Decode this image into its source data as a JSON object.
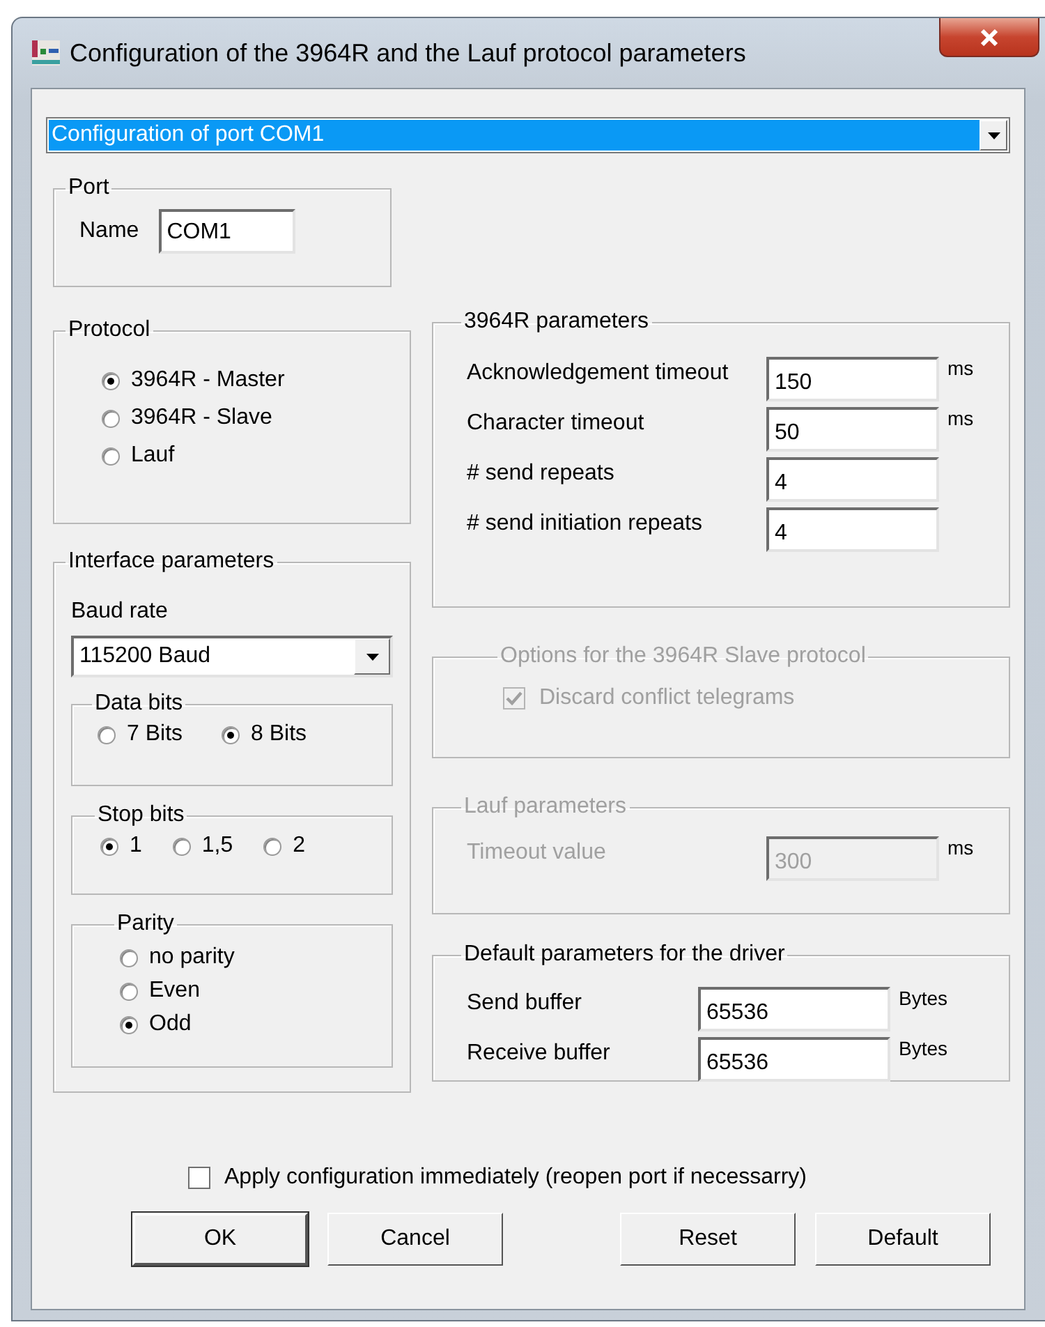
{
  "window": {
    "title": "Configuration of the 3964R and the Lauf protocol parameters"
  },
  "port_selector": {
    "value": "Configuration of port COM1"
  },
  "port": {
    "title": "Port",
    "name_label": "Name",
    "name_value": "COM1"
  },
  "protocol": {
    "title": "Protocol",
    "options": [
      {
        "label": "3964R - Master",
        "selected": true
      },
      {
        "label": "3964R - Slave",
        "selected": false
      },
      {
        "label": "Lauf",
        "selected": false
      }
    ]
  },
  "interface": {
    "title": "Interface parameters",
    "baud_label": "Baud rate",
    "baud_value": "115200 Baud",
    "data_bits": {
      "title": "Data bits",
      "options": [
        {
          "label": "7 Bits",
          "selected": false
        },
        {
          "label": "8 Bits",
          "selected": true
        }
      ]
    },
    "stop_bits": {
      "title": "Stop bits",
      "options": [
        {
          "label": "1",
          "selected": true
        },
        {
          "label": "1,5",
          "selected": false
        },
        {
          "label": "2",
          "selected": false
        }
      ]
    },
    "parity": {
      "title": "Parity",
      "options": [
        {
          "label": "no parity",
          "selected": false
        },
        {
          "label": "Even",
          "selected": false
        },
        {
          "label": "Odd",
          "selected": true
        }
      ]
    }
  },
  "params_3964r": {
    "title": "3964R parameters",
    "disabled": false,
    "fields": [
      {
        "label": "Acknowledgement timeout",
        "value": "150",
        "unit": "ms"
      },
      {
        "label": "Character timeout",
        "value": "50",
        "unit": "ms"
      },
      {
        "label": "# send repeats",
        "value": "4"
      },
      {
        "label": "# send initiation repeats",
        "value": "4"
      }
    ]
  },
  "slave_options": {
    "title": "Options for the 3964R Slave protocol",
    "disabled": true,
    "checkbox": {
      "label": "Discard conflict telegrams",
      "checked": true
    }
  },
  "lauf": {
    "title": "Lauf parameters",
    "disabled": true,
    "fields": [
      {
        "label": "Timeout value",
        "value": "300",
        "unit": "ms"
      }
    ]
  },
  "driver": {
    "title": "Default parameters for the driver",
    "disabled": false,
    "fields": [
      {
        "label": "Send buffer",
        "value": "65536",
        "unit": "Bytes"
      },
      {
        "label": "Receive buffer",
        "value": "65536",
        "unit": "Bytes"
      }
    ]
  },
  "apply": {
    "label": "Apply configuration immediately (reopen port if necessarry)",
    "checked": false
  },
  "buttons": [
    {
      "label": "OK",
      "default": true
    },
    {
      "label": "Cancel",
      "default": false
    },
    {
      "label": "Reset",
      "default": false
    },
    {
      "label": "Default",
      "default": false
    }
  ]
}
